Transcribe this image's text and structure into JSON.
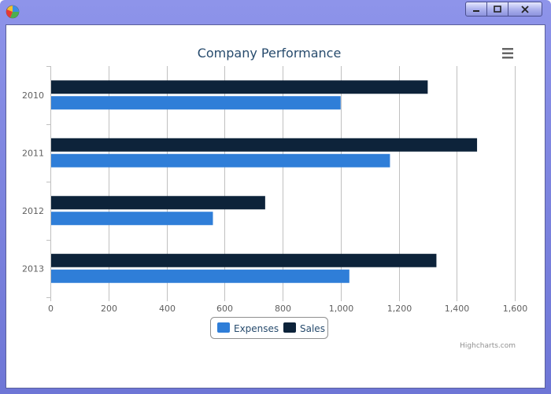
{
  "window": {
    "icon": "pie-chart-icon",
    "controls": [
      "minimize-icon",
      "maximize-icon",
      "close-icon"
    ]
  },
  "chart_menu_icon": "hamburger-menu-icon",
  "colors": {
    "expenses": "#2f7ed8",
    "sales": "#0d233a",
    "grid": "#c0c0c0",
    "title": "#274b6d",
    "axis_text": "#606060"
  },
  "chart_data": {
    "type": "bar",
    "orientation": "horizontal",
    "title": "Company Performance",
    "categories": [
      "2010",
      "2011",
      "2012",
      "2013"
    ],
    "series": [
      {
        "name": "Sales",
        "values": [
          1300,
          1470,
          740,
          1330
        ]
      },
      {
        "name": "Expenses",
        "values": [
          1000,
          1170,
          560,
          1030
        ]
      }
    ],
    "xlim": [
      0,
      1600
    ],
    "tick_labels": [
      "0",
      "200",
      "400",
      "600",
      "800",
      "1,000",
      "1,200",
      "1,400",
      "1,600"
    ],
    "grid": true,
    "legend": {
      "placement": "bottom-center",
      "items": [
        "Expenses",
        "Sales"
      ]
    },
    "credits": "Highcharts.com"
  }
}
